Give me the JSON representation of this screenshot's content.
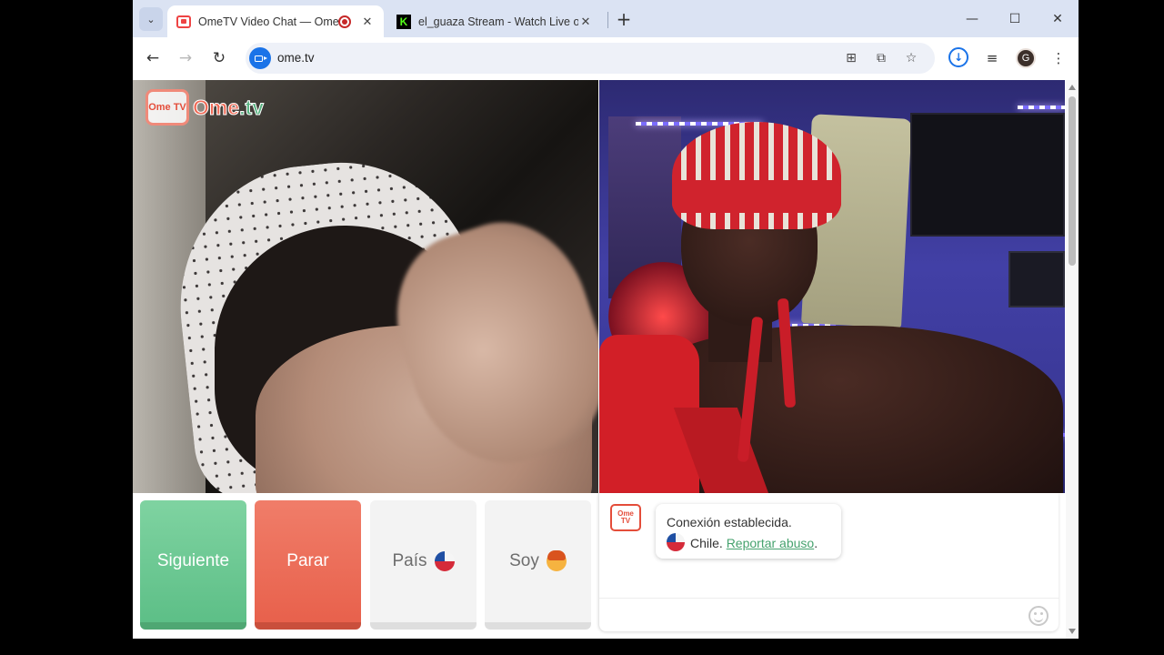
{
  "browser": {
    "tabs": [
      {
        "title": "OmeTV Video Chat — OmeTV",
        "active": true
      },
      {
        "title": "el_guaza Stream - Watch Live on Kick",
        "active": false
      }
    ],
    "new_tab_label": "+",
    "address": "ome.tv",
    "profile_initial": "G",
    "icons": [
      "tab-search-icon",
      "translate-icon",
      "install-app-icon",
      "bookmark-star-icon",
      "download-icon",
      "media-control-icon",
      "menu-icon"
    ]
  },
  "page": {
    "logo": {
      "badge": "Ome TV",
      "text_main": "Ome",
      "text_tv": ".tv"
    },
    "buttons": {
      "next": "Siguiente",
      "stop": "Parar",
      "country": "País",
      "me": "Soy"
    },
    "chat": {
      "logo_badge": "Ome TV",
      "status": "Conexión establecida.",
      "country": "Chile.",
      "report_link": "Reportar abuso",
      "period": "."
    }
  },
  "colors": {
    "next_button": "#6cc993",
    "stop_button": "#ec6d58",
    "report_link": "#46a26e",
    "brand_red": "#e44d3a"
  }
}
